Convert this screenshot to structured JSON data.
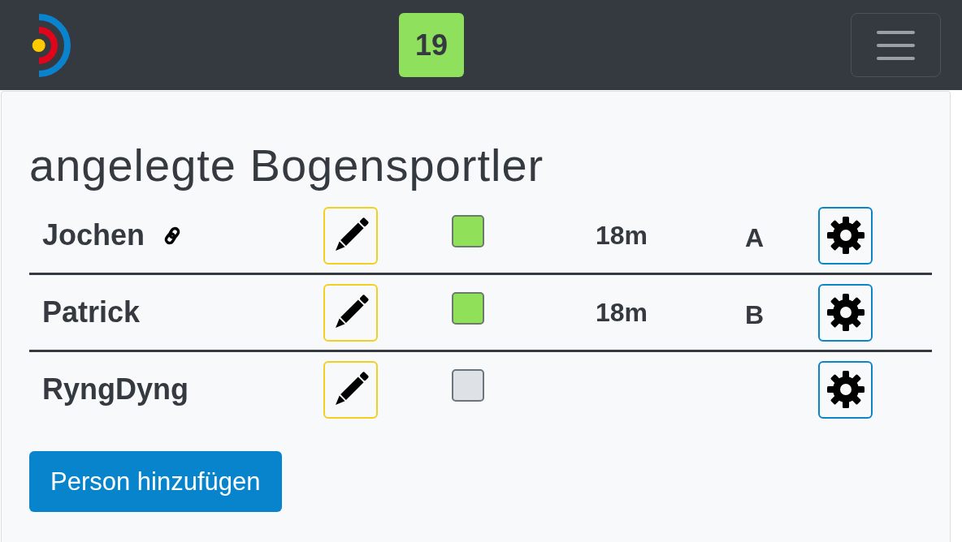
{
  "navbar": {
    "badge": "19"
  },
  "card": {
    "title": "angelegte Bogensportler",
    "athletes": [
      {
        "name": "Jochen",
        "linked": true,
        "checked": true,
        "distance": "18m",
        "column_5": "A"
      },
      {
        "name": "Patrick",
        "linked": false,
        "checked": true,
        "distance": "18m",
        "column_5": "B"
      },
      {
        "name": "RyngDyng",
        "linked": false,
        "checked": false
      }
    ],
    "add_button": "Person hinzufügen"
  }
}
